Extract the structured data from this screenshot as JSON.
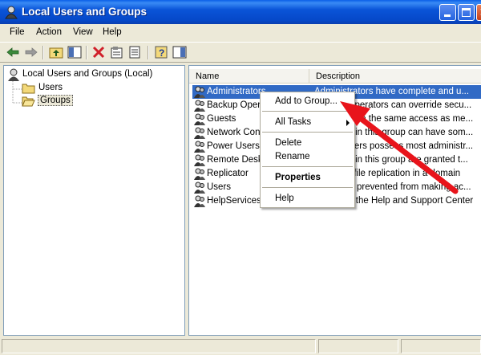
{
  "window": {
    "title": "Local Users and Groups"
  },
  "menubar": {
    "items": [
      "File",
      "Action",
      "View",
      "Help"
    ]
  },
  "tree": {
    "root": "Local Users and Groups (Local)",
    "children": [
      "Users",
      "Groups"
    ],
    "selected": "Groups"
  },
  "list": {
    "columns": [
      "Name",
      "Description"
    ],
    "rows": [
      {
        "name": "Administrators",
        "desc": "Administrators have complete and u..."
      },
      {
        "name": "Backup Operators",
        "desc": "Backup Operators can override secu..."
      },
      {
        "name": "Guests",
        "desc": "Guests have the same access as me..."
      },
      {
        "name": "Network Configuration Operators",
        "desc": "Members in this group can have som..."
      },
      {
        "name": "Power Users",
        "desc": "Power Users possess most administr..."
      },
      {
        "name": "Remote Desktop Users",
        "desc": "Members in this group are granted t..."
      },
      {
        "name": "Replicator",
        "desc": "Supports file replication in a domain"
      },
      {
        "name": "Users",
        "desc": "Users are prevented from making ac..."
      },
      {
        "name": "HelpServicesGroup",
        "desc": "Group for the Help and Support Center"
      }
    ],
    "selected_row": "Administrators"
  },
  "context_menu": {
    "add_to_group": "Add to Group...",
    "all_tasks": "All Tasks",
    "delete": "Delete",
    "rename": "Rename",
    "properties": "Properties",
    "help": "Help"
  },
  "colors": {
    "selection": "#316AC5",
    "annotation_arrow": "#E8141B"
  }
}
